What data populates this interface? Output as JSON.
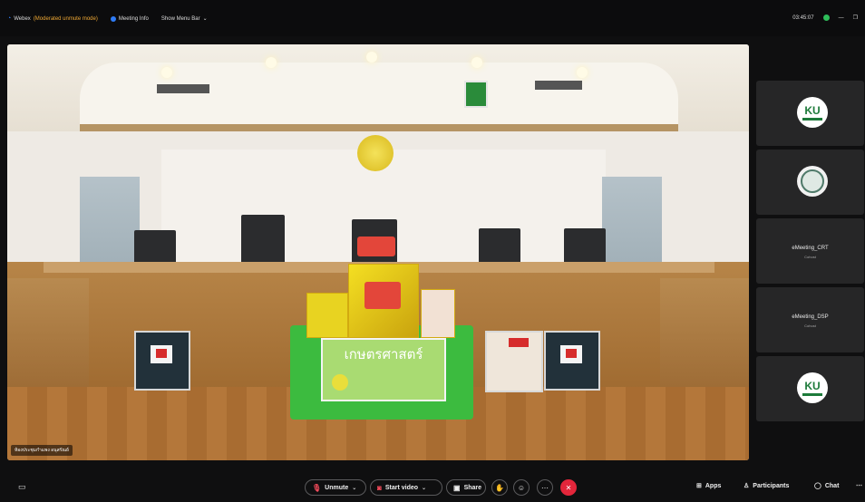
{
  "topbar": {
    "app_name": "Webex",
    "mode": "(Moderated unmute mode)",
    "meeting_info": "Meeting Info",
    "show_menu": "Show Menu Bar",
    "time": "03:45:07"
  },
  "video": {
    "name_label": "ห้องประชุมกำแพง อนุสรัณย์",
    "banner_text": "เกษตรศาสตร์"
  },
  "participants": [
    {
      "type": "logo",
      "logo": "KU"
    },
    {
      "type": "seal"
    },
    {
      "type": "name",
      "name": "eMeeting_CRT",
      "sub": "Cohost"
    },
    {
      "type": "name",
      "name": "eMeeting_DSP",
      "sub": "Cohost"
    },
    {
      "type": "logo",
      "logo": "KU"
    }
  ],
  "toolbar": {
    "unmute": "Unmute",
    "start_video": "Start video",
    "share": "Share",
    "apps": "Apps",
    "participants": "Participants",
    "chat": "Chat"
  },
  "colors": {
    "end_red": "#e3263b",
    "webex_blue": "#2f7cf6",
    "mode_orange": "#f0a935"
  }
}
